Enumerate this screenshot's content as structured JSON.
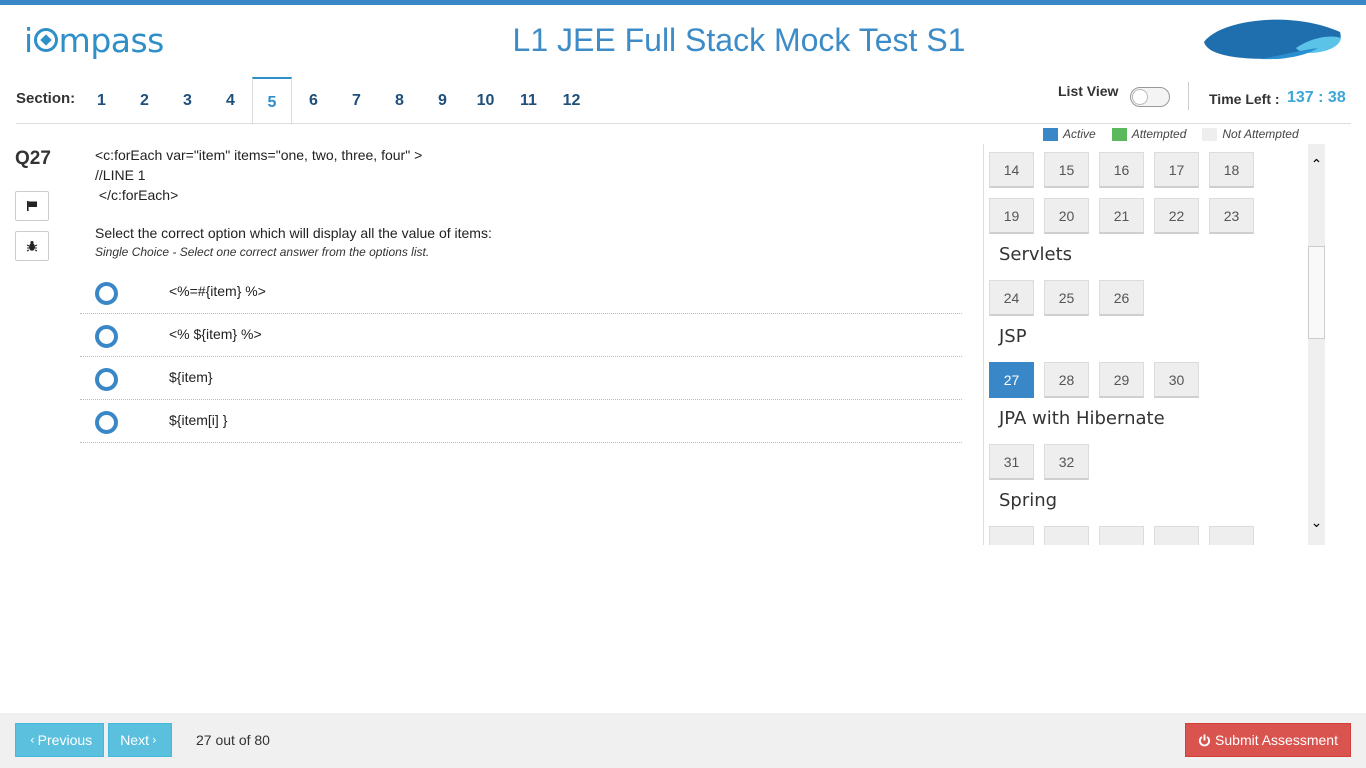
{
  "header": {
    "logo_text_pre": "i",
    "logo_text_post": "mpass",
    "title": "L1 JEE Full Stack Mock Test S1"
  },
  "sections": {
    "label": "Section:",
    "tabs": [
      "1",
      "2",
      "3",
      "4",
      "5",
      "6",
      "7",
      "8",
      "9",
      "10",
      "11",
      "12"
    ],
    "active": "5"
  },
  "controls": {
    "list_view_label": "List View",
    "list_view_on": false,
    "time_left_label": "Time Left :",
    "time_left_value": "137 : 38"
  },
  "legend": {
    "active": {
      "label": "Active",
      "color": "#3a87c8"
    },
    "attempted": {
      "label": "Attempted",
      "color": "#5cb85c"
    },
    "not_attempted": {
      "label": "Not Attempted",
      "color": "#eeeeee"
    }
  },
  "question": {
    "number": "Q27",
    "code_lines": [
      "<c:forEach var=\"item\" items=\"one, two, three, four\" >",
      "//LINE 1",
      " </c:forEach>"
    ],
    "prompt": "Select the correct option which will display all the value of items:",
    "hint": "Single Choice - Select one correct answer from the options list.",
    "options": [
      "<%=#{item} %>",
      "<% ${item} %>",
      "${item}",
      "${item[i] }"
    ],
    "flag_icon": "flag-icon",
    "bug_icon": "bug-icon"
  },
  "palette": {
    "row1": [
      "14",
      "15",
      "16",
      "17",
      "18"
    ],
    "row2": [
      "19",
      "20",
      "21",
      "22",
      "23"
    ],
    "groups": [
      {
        "name": "Servlets",
        "items": [
          "24",
          "25",
          "26"
        ]
      },
      {
        "name": "JSP",
        "items": [
          "27",
          "28",
          "29",
          "30"
        ]
      },
      {
        "name": "JPA with Hibernate",
        "items": [
          "31",
          "32"
        ]
      },
      {
        "name": "Spring",
        "items": []
      }
    ],
    "active_item": "27"
  },
  "footer": {
    "prev_label": "Previous",
    "next_label": "Next",
    "progress": "27 out of 80",
    "submit_label": "Submit Assessment"
  }
}
